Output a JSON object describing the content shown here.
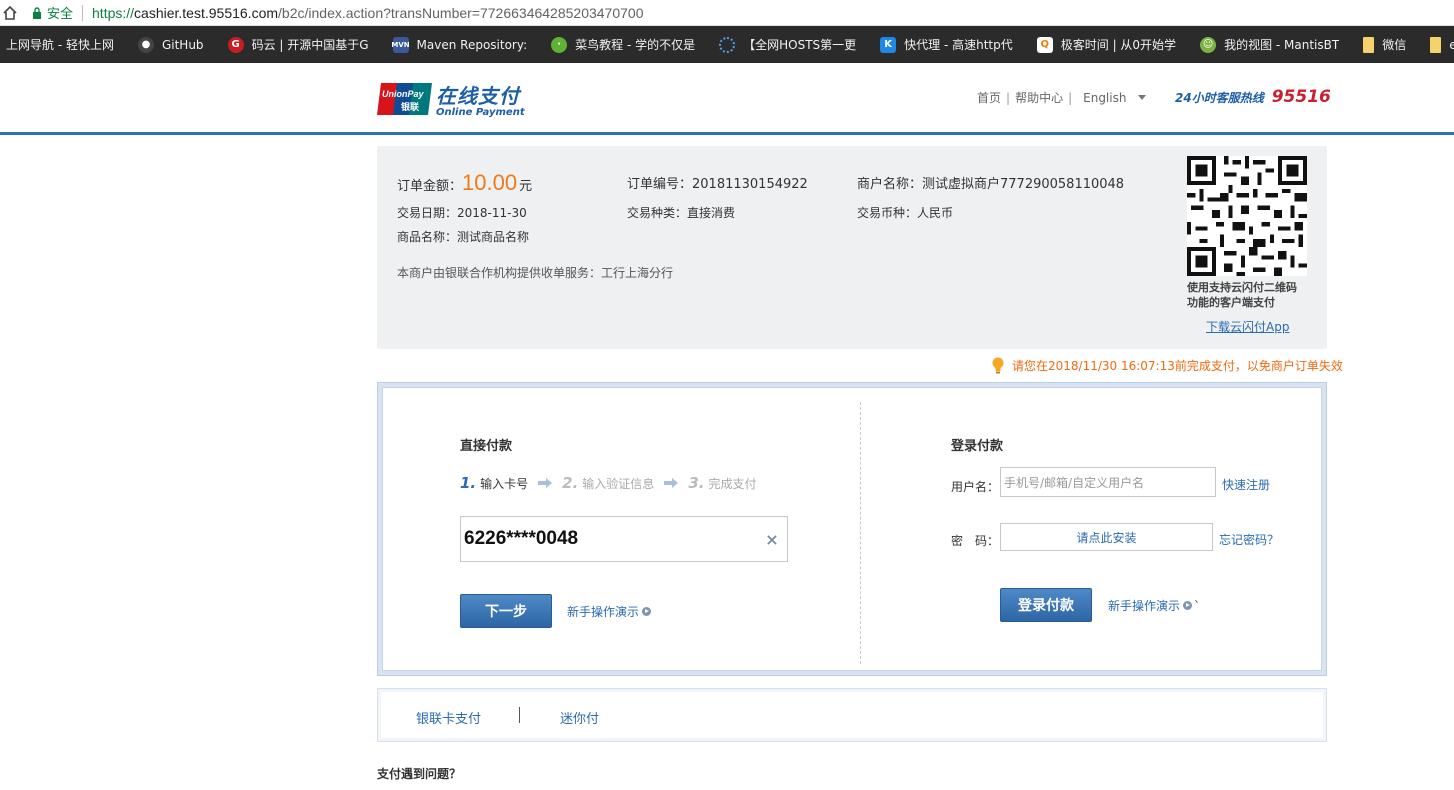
{
  "browser": {
    "secure_label": "安全",
    "url_scheme": "https://",
    "url_host": "cashier.test.95516.com",
    "url_path": "/b2c/index.action?transNumber=772663464285203470700"
  },
  "bookmarks": [
    {
      "label": "上网导航 - 轻快上网",
      "icon": "nav-icon",
      "color": "#2b2b2b"
    },
    {
      "label": "GitHub",
      "icon": "github-icon",
      "color": "#444444"
    },
    {
      "label": "码云 | 开源中国基于G",
      "icon": "gitee-icon",
      "color": "#c71d23"
    },
    {
      "label": "Maven Repository: ",
      "icon": "maven-icon",
      "color": "#3b5998"
    },
    {
      "label": "菜鸟教程 - 学的不仅是",
      "icon": "runoob-icon",
      "color": "#5fb233"
    },
    {
      "label": "【全网HOSTS第一更",
      "icon": "hosts-icon",
      "color": "#1a73e8"
    },
    {
      "label": "快代理 - 高速http代",
      "icon": "kuaidaili-icon",
      "color": "#1e88e5"
    },
    {
      "label": "极客时间 | 从0开始学",
      "icon": "geektime-icon",
      "color": "#f57c00"
    },
    {
      "label": "我的视图 - MantisBT",
      "icon": "mantis-icon",
      "color": "#7cb342"
    },
    {
      "label": "微信",
      "icon": "folder-icon",
      "color": "#f4d36b"
    },
    {
      "label": "elastic",
      "icon": "folder-icon",
      "color": "#f4d36b"
    }
  ],
  "header": {
    "logo_cn": "在线支付",
    "logo_en": "Online Payment",
    "logo_badge_top": "UnionPay",
    "logo_badge_bottom": "银联",
    "nav_home": "首页",
    "nav_help": "帮助中心",
    "lang": "English",
    "hotline_label": "24小时客服热线",
    "hotline_number": "95516",
    "colors": {
      "brand_blue": "#1d5ea8",
      "brand_red": "#c7202e"
    }
  },
  "order": {
    "amount_label": "订单金额：",
    "amount_value": "10.00",
    "amount_unit": "元",
    "order_no_label": "订单编号：",
    "order_no": "20181130154922",
    "merchant_label": "商户名称：",
    "merchant": "测试虚拟商户777290058110048",
    "date_label": "交易日期：",
    "date": "2018-11-30",
    "type_label": "交易种类：",
    "type": "直接消费",
    "currency_label": "交易币种：",
    "currency": "人民币",
    "product_label": "商品名称：",
    "product": "测试商品名称",
    "service_note": "本商户由银联合作机构提供收单服务：工行上海分行",
    "qr_text_1": "使用支持云闪付二维码",
    "qr_text_2": "功能的客户端支付",
    "qr_link": "下载云闪付App",
    "accent_color": "#f07a1b"
  },
  "notice": "请您在2018/11/30 16:07:13前完成支付，以免商户订单失效",
  "direct": {
    "title": "直接付款",
    "steps": [
      {
        "num": "1.",
        "label": "输入卡号"
      },
      {
        "num": "2.",
        "label": "输入验证信息"
      },
      {
        "num": "3.",
        "label": "完成支付"
      }
    ],
    "card_value": "6226****0048",
    "clear": "×",
    "next_button": "下一步",
    "demo": "新手操作演示"
  },
  "login": {
    "title": "登录付款",
    "username_label": "用户名：",
    "username_placeholder": "手机号/邮箱/自定义用户名",
    "register": "快速注册",
    "password_label": "密　码：",
    "password_placeholder": "请点此安装",
    "forgot": "忘记密码？",
    "login_button": "登录付款",
    "demo": "新手操作演示",
    "demo_suffix": "`"
  },
  "tabs": [
    {
      "label": "银联卡支付"
    },
    {
      "label": "迷你付"
    }
  ],
  "faq": "支付遇到问题？"
}
